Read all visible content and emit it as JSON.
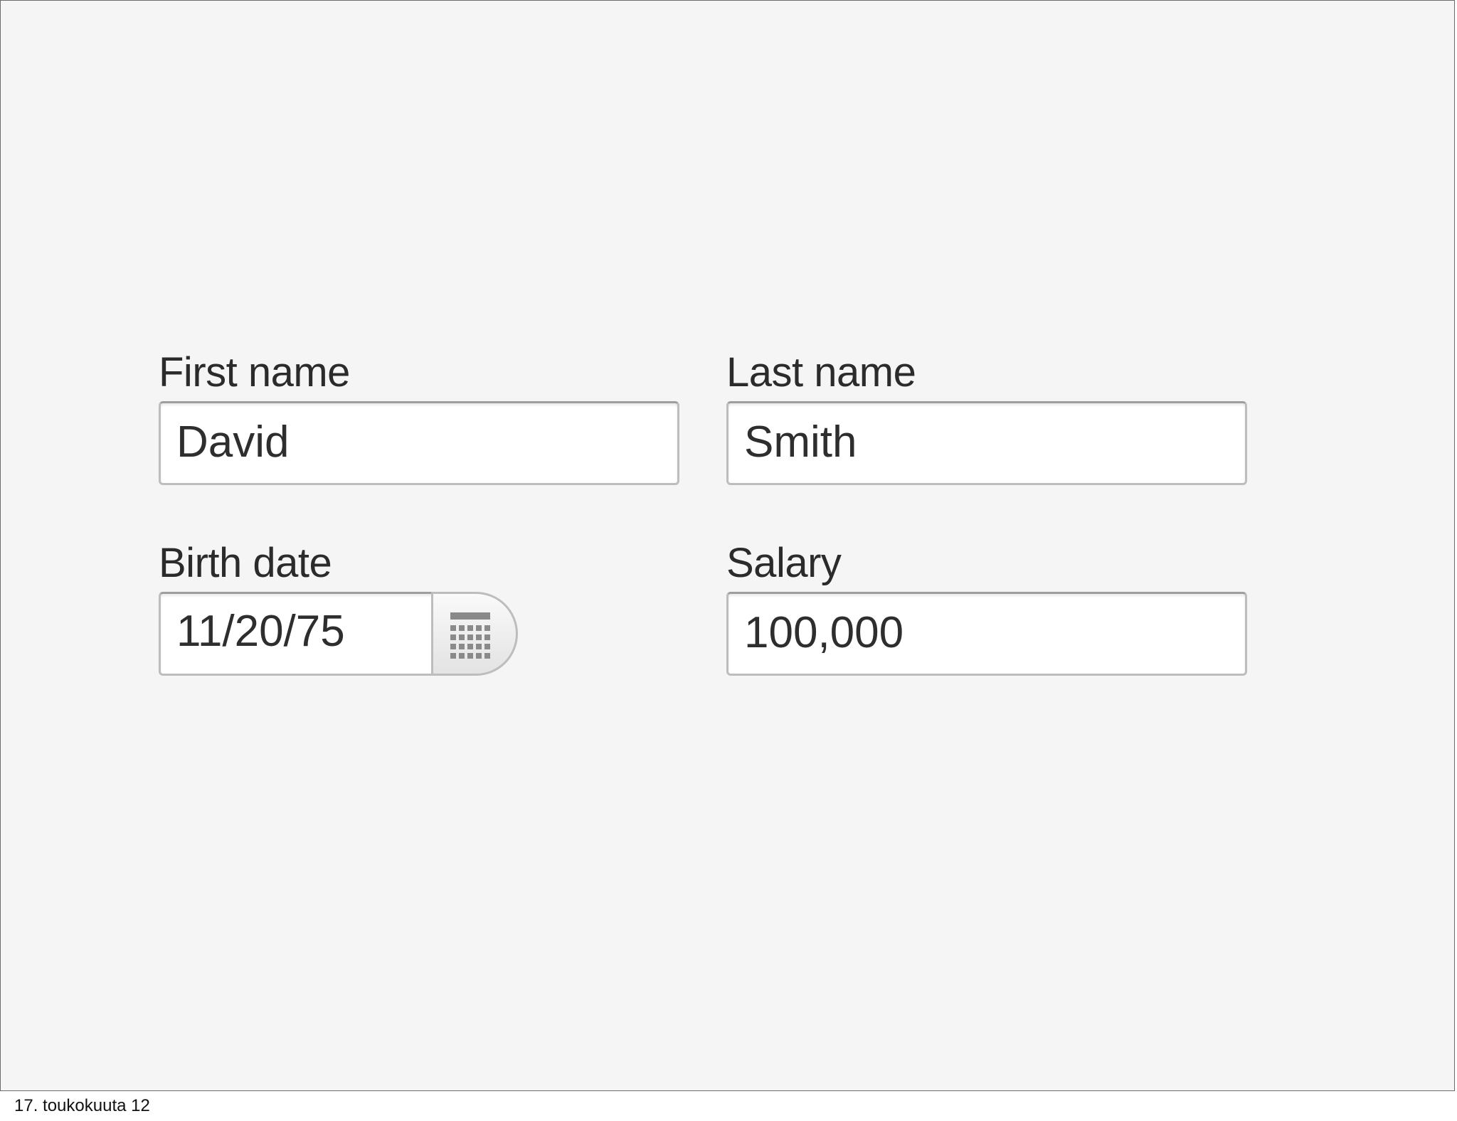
{
  "form": {
    "first_name": {
      "label": "First name",
      "value": "David"
    },
    "last_name": {
      "label": "Last name",
      "value": "Smith"
    },
    "birth_date": {
      "label": "Birth date",
      "value": "11/20/75",
      "button_icon": "calendar-icon"
    },
    "salary": {
      "label": "Salary",
      "value": "100,000"
    }
  },
  "footer": {
    "date": "17. toukokuuta 12"
  },
  "colors": {
    "background": "#f5f5f6",
    "field_border": "#bdbdbd",
    "text": "#2e2e2e"
  }
}
